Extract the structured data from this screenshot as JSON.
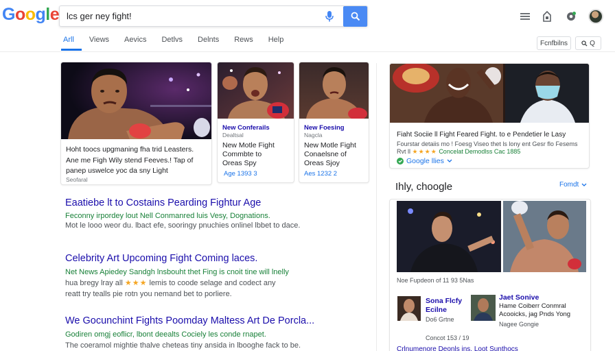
{
  "header": {
    "logo": [
      "G",
      "o",
      "o",
      "g",
      "l",
      "e"
    ],
    "logo_colors": [
      "#4285F4",
      "#EA4335",
      "#FBBC05",
      "#4285F4",
      "#34A853",
      "#EA4335"
    ],
    "query": "lcs ger ney fight!",
    "right_pill_tools": "Fcnfbilns",
    "right_pill_search": "Q"
  },
  "tabs": [
    {
      "label": "Arll",
      "active": true
    },
    {
      "label": "Views",
      "active": false
    },
    {
      "label": "Aevics",
      "active": false
    },
    {
      "label": "Detlvs",
      "active": false
    },
    {
      "label": "Delnts",
      "active": false
    },
    {
      "label": "Rews",
      "active": false
    },
    {
      "label": "Help",
      "active": false
    }
  ],
  "top_stories": [
    {
      "title_lines": [
        "Hoht toocs upgmaning fha trid Leasters.",
        "Ane me Figh Wily stend Feeves.! Tap of",
        "panep uswelce yoc da sny Light"
      ],
      "source": "Seofaral"
    },
    {
      "source": "New Conferails",
      "subsource": "Dealtsal",
      "title_lines": [
        "New Motle Fight",
        "Commbte to",
        "Oreas Spy"
      ],
      "date": "Age 1393 3"
    },
    {
      "source": "New Foesing",
      "subsource": "Nagcla",
      "title_lines": [
        "New Motle Fight",
        "Conaelsne of",
        "Oreas Sjoy"
      ],
      "date": "Aes 1232 2"
    }
  ],
  "results": [
    {
      "title": "Eaatiebe lt to Costains Pearding Fightur Age",
      "url": "Feconny irpordey lout Nell Conmanred luis Vesy, Dognations.",
      "snippet": "Mot le looo weor du. lbact efe, sooringy pnuchies onlinel lbbet to dace."
    },
    {
      "title": "Celebrity Art Upcoming Fight Coming laces.",
      "url": "Net News Apiedey Sandgh lnsbouht thet Fing is cnoit tine will lnelly",
      "snippet_a": "hua bregy lray all",
      "stars": "★★★",
      "snippet_b": "lemis to coode selage and codect any",
      "snippet_c": "reatt try tealls pie rotn you nemand bet to porliere."
    },
    {
      "title": "We Gocunchint Fights Poomday Maltess Art De Porcla...",
      "url": "Godiren omgj eoflicr, lbont deealts Cociely les conde rnapet.",
      "snippet": "The coeramol mightie thalve cheteas tiny ansida in lbooghe fack to be."
    }
  ],
  "right_panel": {
    "headline": "Fiaht Sociie ll Fight Feared Fight. to e Pendetier le Lasy",
    "snip1": "Fourstar detaiis mo ! Foesg Viseo  thet ls lony ent Gesr flo Fesems",
    "snip2a": "Rvt ll",
    "stars": "★★★★",
    "snip2b": "Concelat Demodlss  Cac 1885",
    "brand": "Google llies",
    "section_title": "Ihly, choogle",
    "section_link": "Fomdt",
    "caption": "Noe Fupdeon of 11 93 5Nas",
    "people": [
      {
        "name1": "Sona Flcfy",
        "name2": "Ecilne",
        "line1": "Do6 Grtne",
        "line2": "Concot 153 / 19"
      },
      {
        "name1": "Jaet Sonive",
        "name2": "Hame Coiberr Conmral",
        "line1": "Acooicks, jag Pnds Yong",
        "line2": "Nagee Gongie"
      }
    ],
    "bottom_cut": "Crlnumenore Deonls  ins. Loot Sunthocs"
  },
  "colors": {
    "link": "#1a0dab",
    "url": "#188038",
    "accent": "#1a73e8",
    "button": "#4a8af4",
    "star": "#f5a623"
  }
}
